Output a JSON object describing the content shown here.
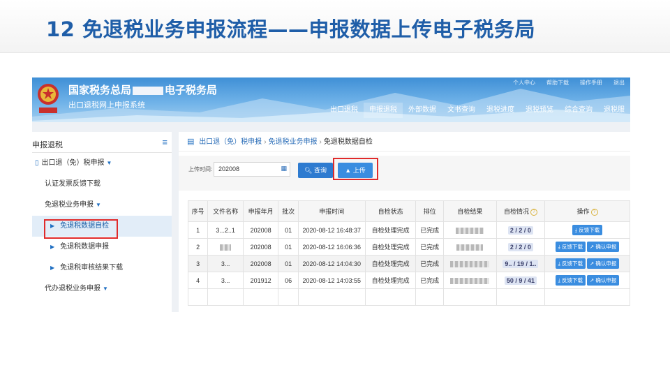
{
  "slide": {
    "title": "12 免退税业务申报流程——申报数据上传电子税务局"
  },
  "header": {
    "brand_prefix": "国家税务总局",
    "brand_suffix": "电子税务局",
    "subtitle": "出口退税网上申报系统",
    "nav": [
      {
        "label": "出口退税",
        "active": false
      },
      {
        "label": "申报退税",
        "active": true
      },
      {
        "label": "外部数据",
        "active": false
      },
      {
        "label": "文书查询",
        "active": false
      },
      {
        "label": "退税进度",
        "active": false
      },
      {
        "label": "退税预览",
        "active": false
      },
      {
        "label": "综合查询",
        "active": false
      },
      {
        "label": "退税服",
        "active": false
      }
    ],
    "top_links": "个人中心　　帮助下载　　操作手册　　退出"
  },
  "sidebar": {
    "title": "申报退税",
    "items": [
      {
        "label": "出口退（免）税申报",
        "level": 1
      },
      {
        "label": "认证发票反馈下载",
        "level": 2
      },
      {
        "label": "免退税业务申报",
        "level": 2
      },
      {
        "label": "免退税数据自检",
        "level": 3
      },
      {
        "label": "免退税数据申报",
        "level": 3
      },
      {
        "label": "免退税审核结果下载",
        "level": 3
      },
      {
        "label": "代办退税业务申报",
        "level": 2
      }
    ]
  },
  "breadcrumb": {
    "a": "出口退（免）税申报",
    "b": "免退税业务申报",
    "c": "免退税数据自检"
  },
  "filter": {
    "label": "上传时间:",
    "value": "202008",
    "query_label": "查询",
    "upload_label": "上传"
  },
  "table": {
    "headers": [
      "序号",
      "文件名称",
      "申报年月",
      "批次",
      "申报时间",
      "自检状态",
      "排位",
      "自检结果",
      "自检情况",
      "操作"
    ],
    "rows": [
      {
        "no": "1",
        "file": "3...2..1",
        "ym": "202008",
        "batch": "01",
        "time": "2020-08-12 16:48:37",
        "status": "自检处理完成",
        "rank": "已完成",
        "situation": "2 / 2 / 0",
        "actions": [
          "反馈下载"
        ]
      },
      {
        "no": "2",
        "file": "",
        "ym": "202008",
        "batch": "01",
        "time": "2020-08-12 16:06:36",
        "status": "自检处理完成",
        "rank": "已完成",
        "situation": "2 / 2 / 0",
        "actions": [
          "反馈下载",
          "确认申报"
        ]
      },
      {
        "no": "3",
        "file": "3...",
        "ym": "202008",
        "batch": "01",
        "time": "2020-08-12 14:04:30",
        "status": "自检处理完成",
        "rank": "已完成",
        "situation": "9.. / 19 / 1..",
        "actions": [
          "反馈下载",
          "确认申报"
        ]
      },
      {
        "no": "4",
        "file": "3...",
        "ym": "201912",
        "batch": "06",
        "time": "2020-08-12 14:03:55",
        "status": "自检处理完成",
        "rank": "已完成",
        "situation": "50 / 9 / 41",
        "actions": [
          "反馈下载",
          "确认申报"
        ]
      }
    ]
  },
  "colors": {
    "title_blue": "#1f5ea8",
    "banner_blue": "#3f8fd6",
    "button_blue": "#3a8de0",
    "highlight_red": "#e02a2a"
  }
}
